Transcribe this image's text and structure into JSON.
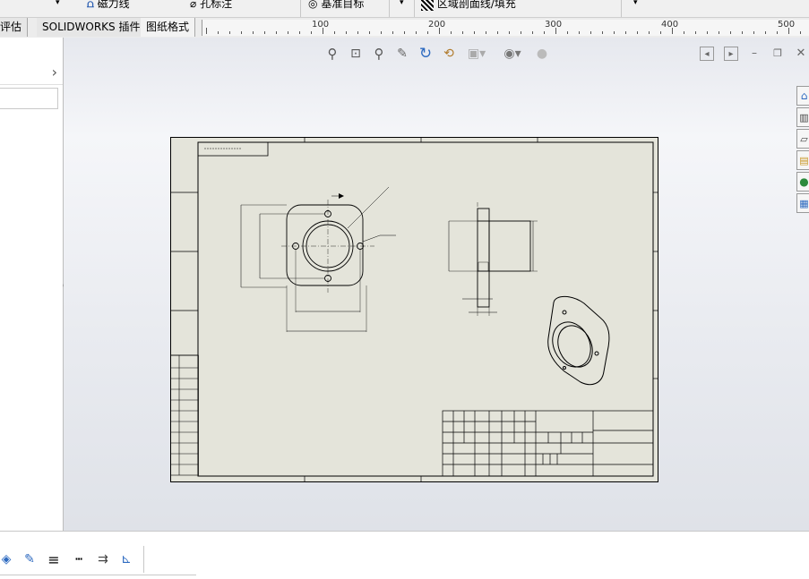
{
  "toolbar": {
    "items": [
      {
        "label": "磁力线",
        "icon": "magnet-line-icon"
      },
      {
        "label": "孔标注",
        "icon": "hole-callout-icon"
      },
      {
        "label": "基准目标",
        "icon": "datum-target-icon"
      },
      {
        "label": "区域剖面线/填充",
        "icon": "area-hatch-icon"
      }
    ]
  },
  "tabs": [
    "评估",
    "SOLIDWORKS 插件",
    "图纸格式"
  ],
  "ruler": {
    "labels": [
      "100",
      "200",
      "300",
      "400",
      "500"
    ]
  },
  "view_toolbar": {
    "icons": [
      "zoom-to-fit-icon",
      "zoom-to-area-icon",
      "zoom-in-out-icon",
      "pan-icon",
      "rotate-icon",
      "previous-view-icon",
      "display-style-icon",
      "hide-show-icon",
      "appearance-icon"
    ]
  },
  "window_controls": {
    "icons": [
      "previous-window-icon",
      "next-window-icon",
      "minimize-icon",
      "restore-icon",
      "close-icon"
    ]
  },
  "task_pane": {
    "icons": [
      "home-icon",
      "design-library-icon",
      "file-explorer-icon",
      "view-palette-icon",
      "appearances-icon",
      "custom-properties-icon"
    ]
  },
  "bottom_toolbar": {
    "icons": [
      "layer-icon",
      "line-color-icon",
      "line-thickness-icon",
      "line-style-icon",
      "hide-edge-icon",
      "color-display-icon"
    ]
  },
  "colors": {
    "sheet": "#e4e4da",
    "accent": "#3b73c4"
  }
}
